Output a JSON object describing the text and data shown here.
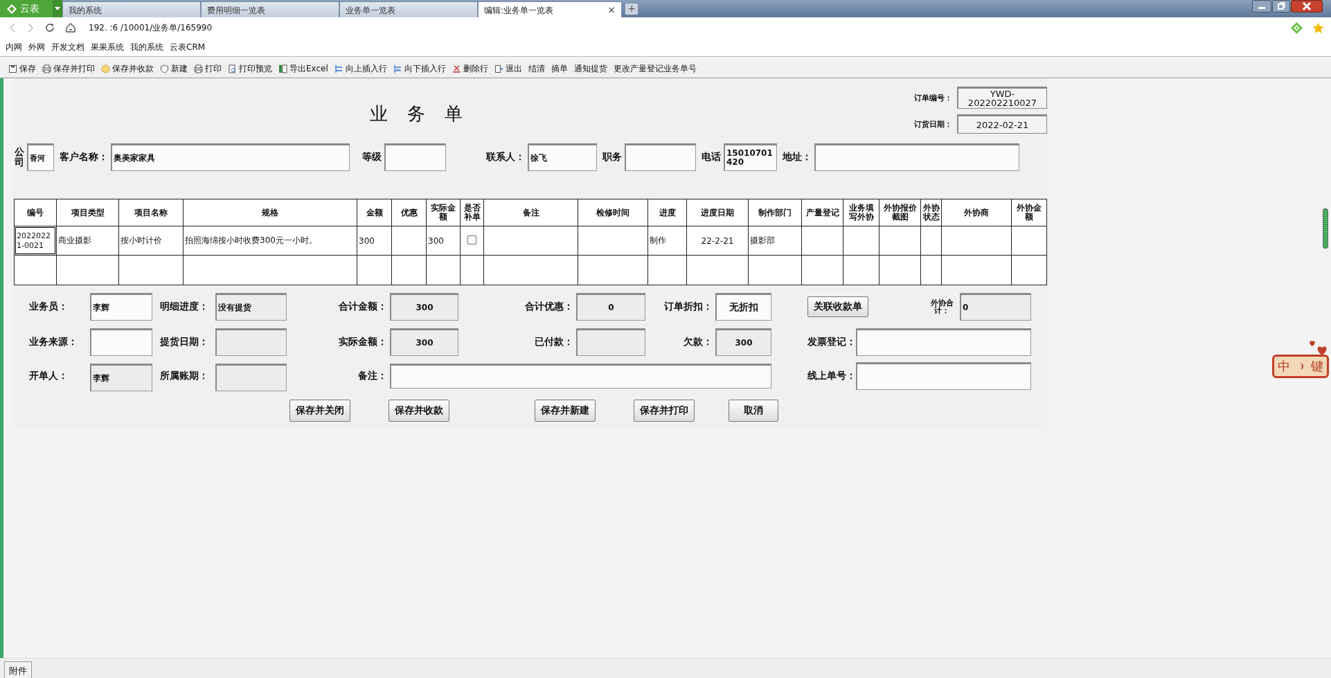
{
  "browser": {
    "logo": "云表",
    "tabs": [
      {
        "label": "我的系统",
        "selected": false
      },
      {
        "label": "费用明细一览表",
        "selected": false
      },
      {
        "label": "业务单一览表",
        "selected": false
      },
      {
        "label": "编辑:业务单一览表",
        "selected": true
      }
    ],
    "close_glyph": "×",
    "new_tab_glyph": "+",
    "address": "192.  :6  /10001/业务单/165990",
    "bookmarks": [
      "内网",
      "外网",
      "开发文档",
      "果果系统",
      "我的系统",
      "云表CRM"
    ]
  },
  "toolbar": [
    {
      "label": "保存",
      "kind": "doc"
    },
    {
      "label": "保存并打印",
      "kind": "print"
    },
    {
      "label": "保存并收款",
      "kind": "coin"
    },
    {
      "label": "新建",
      "kind": "shield"
    },
    {
      "label": "打印",
      "kind": "print"
    },
    {
      "label": "打印预览",
      "kind": "preview"
    },
    {
      "label": "导出Excel",
      "kind": "excel"
    },
    {
      "label": "向上插入行",
      "kind": "up"
    },
    {
      "label": "向下插入行",
      "kind": "down"
    },
    {
      "label": "删除行",
      "kind": "delete"
    },
    {
      "label": "退出",
      "kind": "exit"
    },
    {
      "label": "结清",
      "kind": "plain"
    },
    {
      "label": "摘单",
      "kind": "plain"
    },
    {
      "label": "通知提货",
      "kind": "plain"
    },
    {
      "label": "更改产量登记业务单号",
      "kind": "plain"
    }
  ],
  "form": {
    "title": "业务单",
    "order_no": {
      "label": "订单编号：",
      "value": "YWD-202202210027"
    },
    "order_date": {
      "label": "订货日期：",
      "value": "2022-02-21"
    },
    "company": {
      "label": "公司",
      "value": "香河"
    },
    "customer": {
      "label": "客户名称：",
      "value": "奥美家家具"
    },
    "grade": {
      "label": "等级"
    },
    "contact": {
      "label": "联系人：",
      "value": "徐飞"
    },
    "position": {
      "label": "职务"
    },
    "phone": {
      "label": "电话",
      "value": "15010701420"
    },
    "address": {
      "label": "地址："
    }
  },
  "table": {
    "columns": [
      "编号",
      "项目类型",
      "项目名称",
      "规格",
      "金额",
      "优惠",
      "实际金额",
      "是否补单",
      "备注",
      "检修时间",
      "进度",
      "进度日期",
      "制作部门",
      "产量登记",
      "业务填写外协",
      "外协报价截图",
      "外协状态",
      "外协商",
      "外协金额"
    ],
    "rows": [
      {
        "number": "20220221-0021",
        "item_type": "商业摄影",
        "item_name": "按小时计价",
        "spec": "拍照海绵按小时收费300元一小时。",
        "amount": "300",
        "actual_amount": "300",
        "supplement": false,
        "progress": "制作",
        "progress_date": "22-2-21",
        "department": "摄影部"
      }
    ]
  },
  "summary": {
    "salesperson": {
      "label": "业务员：",
      "value": "李辉",
      "readonly": false
    },
    "detail_progress": {
      "label": "明细进度：",
      "value": "没有提货",
      "readonly": true
    },
    "total": {
      "label": "合计金额：",
      "value": "300",
      "readonly": true
    },
    "total_discount": {
      "label": "合计优惠：",
      "value": "0",
      "readonly": true
    },
    "order_discount": {
      "label": "订单折扣：",
      "value": "无折扣",
      "readonly": false
    },
    "link_button": "关联收款单",
    "outsource_total": {
      "label": "外协合计：",
      "value": "0",
      "readonly": true
    },
    "source": {
      "label": "业务来源：",
      "readonly": false
    },
    "pickup_date": {
      "label": "提货日期：",
      "readonly": true
    },
    "actual": {
      "label": "实际金额：",
      "value": "300",
      "readonly": true
    },
    "paid": {
      "label": "已付款：",
      "readonly": true
    },
    "owed": {
      "label": "欠款：",
      "value": "300",
      "readonly": true
    },
    "invoice": {
      "label": "发票登记：",
      "readonly": false
    },
    "creator": {
      "label": "开单人：",
      "value": "李辉",
      "readonly": true
    },
    "period": {
      "label": "所属账期：",
      "readonly": true
    },
    "remark": {
      "label": "备注：",
      "readonly": false
    },
    "online_no": {
      "label": "线上单号：",
      "readonly": false
    }
  },
  "buttons": [
    "保存并关闭",
    "保存并收款",
    "保存并新建",
    "保存并打印",
    "取消"
  ],
  "ime": {
    "left": "中",
    "right": "键"
  },
  "bottom_tab": "附件"
}
